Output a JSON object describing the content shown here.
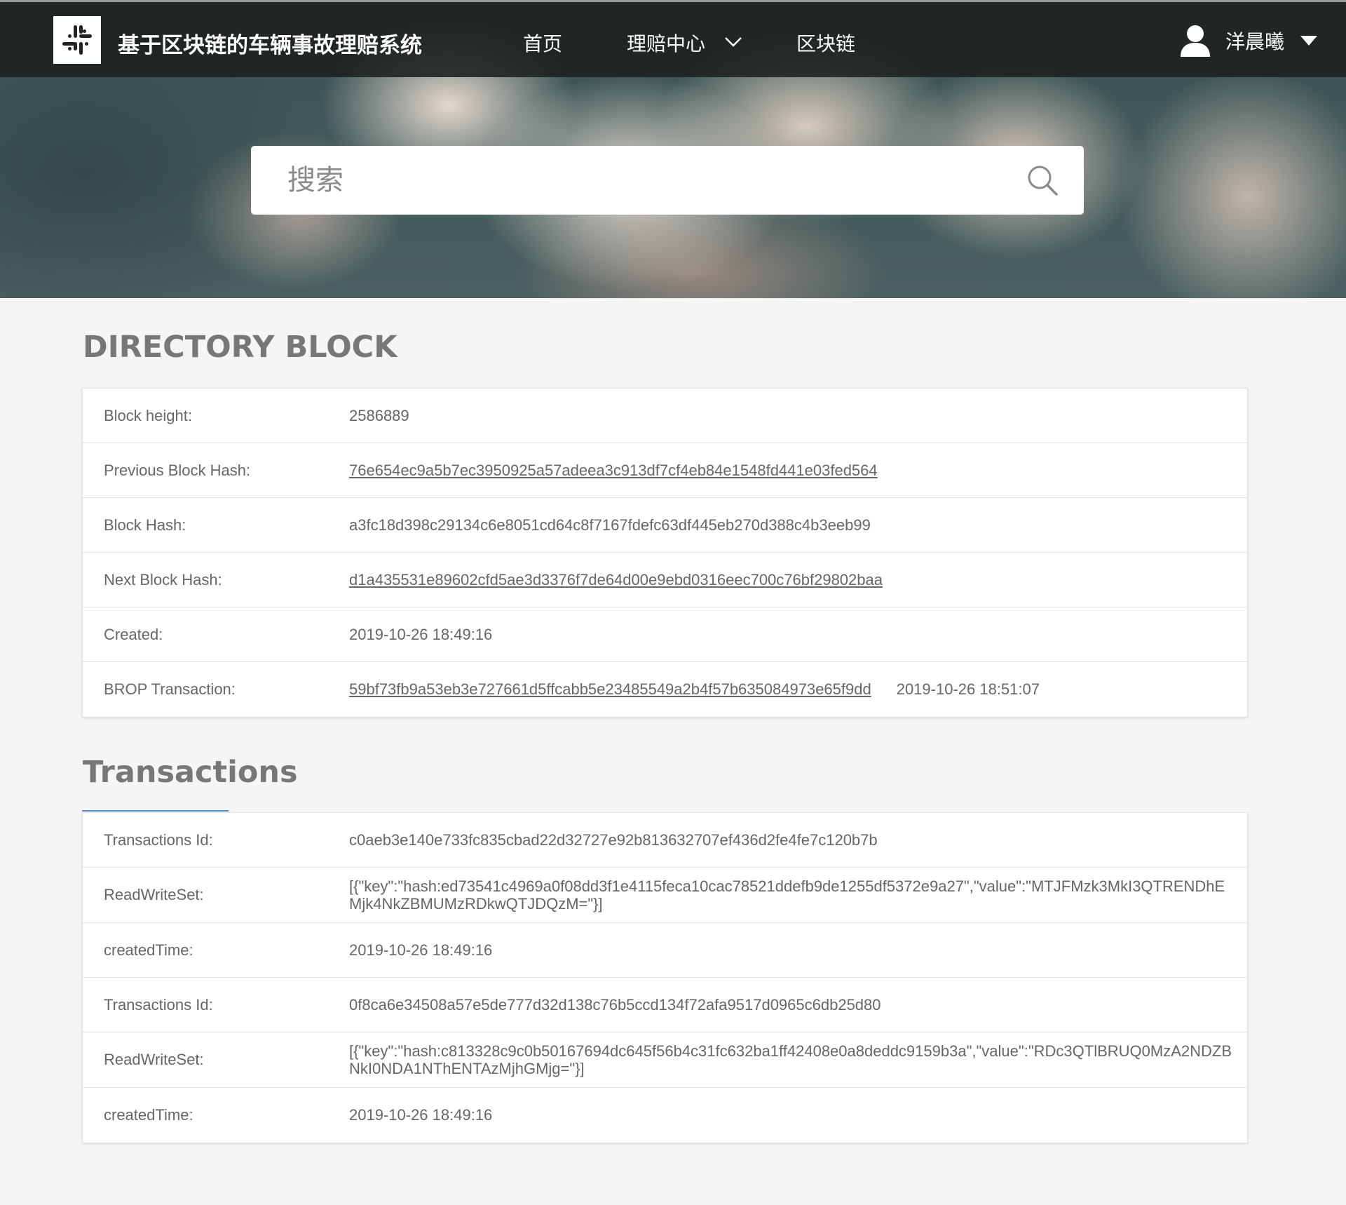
{
  "nav": {
    "brand": "基于区块链的车辆事故理赔系统",
    "home": "首页",
    "claims": "理赔中心",
    "blockchain": "区块链",
    "user_name": "洋晨曦"
  },
  "search": {
    "placeholder": "搜索"
  },
  "directory_block": {
    "title": "DIRECTORY BLOCK",
    "rows": [
      {
        "label": "Block height:",
        "value": "2586889"
      },
      {
        "label": "Previous Block Hash:",
        "value": "76e654ec9a5b7ec3950925a57adeea3c913df7cf4eb84e1548fd441e03fed564"
      },
      {
        "label": "Block Hash:",
        "value": "a3fc18d398c29134c6e8051cd64c8f7167fdefc63df445eb270d388c4b3eeb99"
      },
      {
        "label": "Next Block Hash:",
        "value": "d1a435531e89602cfd5ae3d3376f7de64d00e9ebd0316eec700c76bf29802baa"
      },
      {
        "label": "Created:",
        "value": "2019-10-26 18:49:16"
      },
      {
        "label": "BROP Transaction:",
        "value": "59bf73fb9a53eb3e727661d5ffcabb5e23485549a2b4f57b635084973e65f9dd",
        "extra": "2019-10-26 18:51:07"
      }
    ]
  },
  "transactions": {
    "title": "Transactions",
    "rows": [
      {
        "label": "Transactions Id:",
        "value": "c0aeb3e140e733fc835cbad22d32727e92b813632707ef436d2fe4fe7c120b7b"
      },
      {
        "label": "ReadWriteSet:",
        "value": "[{\"key\":\"hash:ed73541c4969a0f08dd3f1e4115feca10cac78521ddefb9de1255df5372e9a27\",\"value\":\"MTJFMzk3MkI3QTRENDhEMjk4NkZBMUMzRDkwQTJDQzM=\"}]"
      },
      {
        "label": "createdTime:",
        "value": "2019-10-26 18:49:16"
      },
      {
        "label": "Transactions Id:",
        "value": "0f8ca6e34508a57e5de777d32d138c76b5ccd134f72afa9517d0965c6db25d80"
      },
      {
        "label": "ReadWriteSet:",
        "value": "[{\"key\":\"hash:c813328c9c0b50167694dc645f56b4c31fc632ba1ff42408e0a8deddc9159b3a\",\"value\":\"RDc3QTlBRUQ0MzA2NDZBNkI0NDA1NThENTAzMjhGMjg=\"}]"
      },
      {
        "label": "createdTime:",
        "value": "2019-10-26 18:49:16"
      }
    ]
  },
  "colors": {
    "navbar_bg": "#1c2020",
    "link": "#666666",
    "tab_underline": "#4a8fd6",
    "page_bg": "#f5f5f5"
  },
  "icons": [
    "slack-logo-icon",
    "chevron-down-icon",
    "user-icon",
    "caret-down-icon",
    "search-icon"
  ]
}
